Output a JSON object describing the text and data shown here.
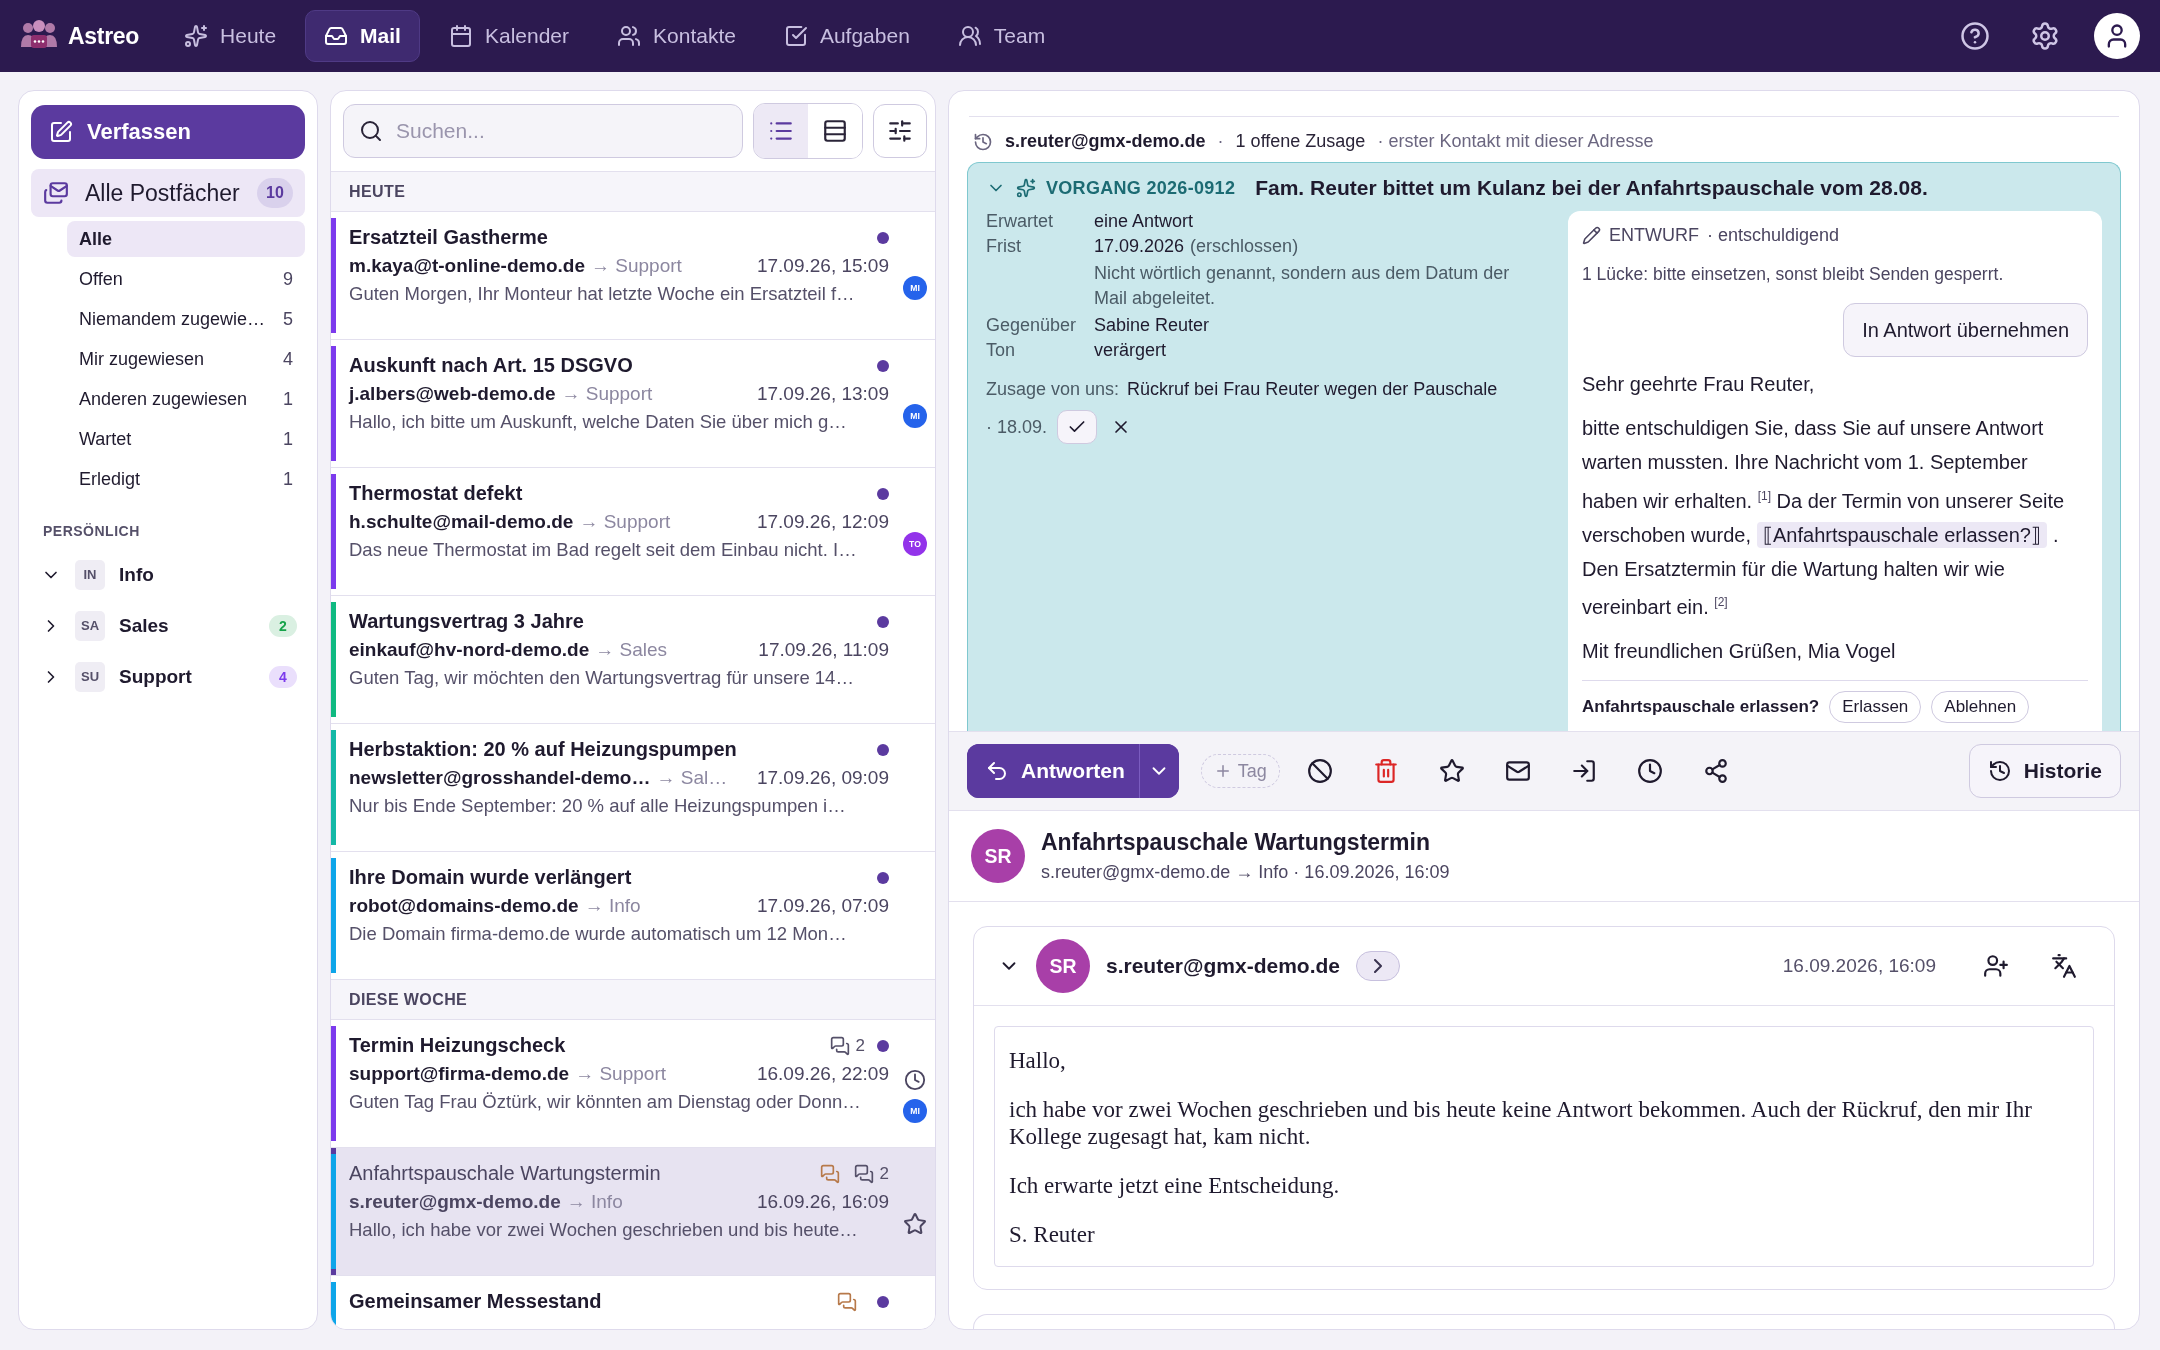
{
  "nav": {
    "brand": "Astreo",
    "items": [
      {
        "label": "Heute",
        "selected": false
      },
      {
        "label": "Mail",
        "selected": true
      },
      {
        "label": "Kalender",
        "selected": false
      },
      {
        "label": "Kontakte",
        "selected": false
      },
      {
        "label": "Aufgaben",
        "selected": false
      },
      {
        "label": "Team",
        "selected": false
      }
    ]
  },
  "sidebar": {
    "compose": "Verfassen",
    "all_mailboxes": {
      "label": "Alle Postfächer",
      "count": "10",
      "selected": true
    },
    "filters": [
      {
        "label": "Alle",
        "selected": true
      },
      {
        "label": "Offen",
        "count": "9",
        "selected": false
      },
      {
        "label": "Niemandem zugewie…",
        "count": "5",
        "selected": false
      },
      {
        "label": "Mir zugewiesen",
        "count": "4",
        "selected": false
      },
      {
        "label": "Anderen zugewiesen",
        "count": "1",
        "selected": false
      },
      {
        "label": "Wartet",
        "count": "1",
        "selected": false
      },
      {
        "label": "Erledigt",
        "count": "1",
        "selected": false
      }
    ],
    "section": "PERSÖNLICH",
    "mailboxes": [
      {
        "abbr": "IN",
        "label": "Info",
        "expanded": true
      },
      {
        "abbr": "SA",
        "label": "Sales",
        "expanded": false,
        "count": "2",
        "color": "#16a34a"
      },
      {
        "abbr": "SU",
        "label": "Support",
        "expanded": false,
        "count": "4",
        "color": "#7c3aed"
      }
    ]
  },
  "list": {
    "search": {
      "placeholder": "Suchen..."
    },
    "views": [
      {
        "kind": "list",
        "selected": true
      },
      {
        "kind": "compact",
        "selected": false
      }
    ],
    "groups": [
      {
        "heading": "HEUTE",
        "mails": [
          {
            "subject": "Ersatzteil Gastherme",
            "sender": "m.kaya@t-online-demo.de",
            "mailbox": "→ Support",
            "time": "17.09.26, 15:09",
            "preview": "Guten Morgen, Ihr Monteur hat letzte Woche ein Ersatzteil f…",
            "unread": true,
            "selected": false,
            "color": "#7c3aed",
            "assignee": {
              "initials": "MI",
              "color": "#2563eb"
            }
          },
          {
            "subject": "Auskunft nach Art. 15 DSGVO",
            "sender": "j.albers@web-demo.de",
            "mailbox": "→ Support",
            "time": "17.09.26, 13:09",
            "preview": "Hallo, ich bitte um Auskunft, welche Daten Sie über mich g…",
            "unread": true,
            "selected": false,
            "color": "#7c3aed",
            "assignee": {
              "initials": "MI",
              "color": "#2563eb"
            }
          },
          {
            "subject": "Thermostat defekt",
            "sender": "h.schulte@mail-demo.de",
            "mailbox": "→ Support",
            "time": "17.09.26, 12:09",
            "preview": "Das neue Thermostat im Bad regelt seit dem Einbau nicht. I…",
            "unread": true,
            "selected": false,
            "color": "#7c3aed",
            "assignee": {
              "initials": "TO",
              "color": "#9333ea"
            }
          },
          {
            "subject": "Wartungsvertrag 3 Jahre",
            "sender": "einkauf@hv-nord-demo.de",
            "mailbox": "→ Sales",
            "time": "17.09.26, 11:09",
            "preview": "Guten Tag, wir möchten den Wartungsvertrag für unsere 14…",
            "unread": true,
            "selected": false,
            "color": "#10b981"
          },
          {
            "subject": "Herbstaktion: 20 % auf Heizungspumpen",
            "sender": "newsletter@grosshandel-demo…",
            "mailbox": "→ Sal…",
            "time": "17.09.26, 09:09",
            "preview": "Nur bis Ende September: 20 % auf alle Heizungspumpen i…",
            "unread": true,
            "selected": false,
            "color": "#14b8a6"
          },
          {
            "subject": "Ihre Domain wurde verlängert",
            "sender": "robot@domains-demo.de",
            "mailbox": "→ Info",
            "time": "17.09.26, 07:09",
            "preview": "Die Domain firma-demo.de wurde automatisch um 12 Mon…",
            "unread": true,
            "selected": false,
            "color": "#0ea5e9"
          }
        ]
      },
      {
        "heading": "DIESE WOCHE",
        "mails": [
          {
            "subject": "Termin Heizungscheck",
            "sender": "support@firma-demo.de",
            "mailbox": "→ Support",
            "time": "16.09.26, 22:09",
            "preview": "Guten Tag Frau Öztürk, wir könnten am Dienstag oder Donn…",
            "unread": true,
            "selected": false,
            "color": "#7c3aed",
            "threads": "2",
            "snoozed": true,
            "assignee": {
              "initials": "MI",
              "color": "#2563eb"
            }
          },
          {
            "subject": "Anfahrtspauschale Wartungstermin",
            "sender": "s.reuter@gmx-demo.de",
            "mailbox": "→ Info",
            "time": "16.09.26, 16:09",
            "preview": "Hallo, ich habe vor zwei Wochen geschrieben und bis heute…",
            "unread": false,
            "selected": true,
            "color": "#0ea5e9",
            "note": true,
            "threads": "2"
          },
          {
            "subject": "Gemeinsamer Messestand",
            "unread": true,
            "selected": false,
            "color": "#0ea5e9",
            "note": true
          }
        ]
      }
    ]
  },
  "context": {
    "sender": "s.reuter@gmx-demo.de",
    "separator": "·",
    "commitments": "1 offene Zusage",
    "note": "· erster Kontakt mit dieser Adresse"
  },
  "case": {
    "expanded": true,
    "label": "VORGANG 2026-0912",
    "summary": "Fam. Reuter bittet um Kulanz bei der Anfahrtspauschale vom 28.08.",
    "facts": [
      {
        "key": "Erwartet",
        "value": "eine Antwort"
      },
      {
        "key": "Frist",
        "value": "17.09.2026",
        "qualifier": "(erschlossen)",
        "note": "Nicht wörtlich genannt, sondern aus dem Datum der Mail abgeleitet."
      },
      {
        "key": "Gegenüber",
        "value": "Sabine Reuter"
      },
      {
        "key": "Ton",
        "value": "verärgert"
      }
    ],
    "commitment": {
      "label": "Zusage von uns:",
      "text": "Rückruf bei Frau Reuter wegen der Pauschale",
      "date": "· 18.09."
    },
    "draft": {
      "label": "ENTWURF",
      "tone": "· entschuldigend",
      "gaps": "1 Lücke: bitte einsetzen, sonst bleibt Senden gesperrt.",
      "apply": "In Antwort übernehmen",
      "paragraphs": [
        [
          {
            "kind": "text",
            "text": "Sehr geehrte Frau Reuter,"
          }
        ],
        [
          {
            "kind": "text",
            "text": "bitte entschuldigen Sie, dass Sie auf unsere Antwort warten mussten. Ihre Nachricht vom 1. September haben wir erhalten. $^{[1]}$ Da der Termin von unserer Seite verschoben wurde,"
          },
          {
            "kind": "gap",
            "text": "⟦Anfahrtspauschale erlassen?⟧"
          },
          {
            "kind": "text",
            "text": ". Den Ersatztermin für die Wartung halten wir wie vereinbart ein. $^{[2]}$"
          }
        ],
        [
          {
            "kind": "text",
            "text": "Mit freundlichen Grüßen, Mia Vogel"
          }
        ]
      ],
      "question": "Anfahrtspauschale erlassen?",
      "options": [
        "Erlassen",
        "Ablehnen"
      ]
    }
  },
  "toolbar": {
    "reply": "Antworten",
    "tag": "Tag",
    "history": "Historie"
  },
  "mail": {
    "initials": "SR",
    "subject": "Anfahrtspauschale Wartungstermin",
    "meta": "s.reuter@gmx-demo.de → Info · 16.09.2026, 16:09",
    "message": {
      "expanded": true,
      "initials": "SR",
      "sender": "s.reuter@gmx-demo.de",
      "date": "16.09.2026, 16:09",
      "body": [
        "Hallo,",
        "ich habe vor zwei Wochen geschrieben und bis heute keine Antwort bekommen. Auch der Rückruf, den mir Ihr Kollege zugesagt hat, kam nicht.",
        "Ich erwarte jetzt eine Entscheidung.",
        "S. Reuter"
      ]
    }
  }
}
